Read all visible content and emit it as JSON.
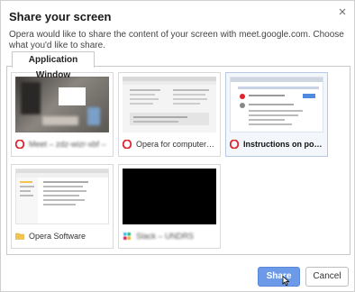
{
  "dialog": {
    "title": "Share your screen",
    "description": "Opera would like to share the content of your screen with meet.google.com. Choose what you'd like to share.",
    "close_icon": "close-icon"
  },
  "tabs": [
    {
      "label": "Application Window",
      "active": true
    }
  ],
  "windows": [
    {
      "label": "Meet – zdz-wizr-xbf –",
      "icon": "opera-icon",
      "blurred": true,
      "bold": false
    },
    {
      "label": "Opera for computers | O...",
      "icon": "opera-icon",
      "blurred": false,
      "bold": false
    },
    {
      "label": "Instructions on postin...",
      "icon": "opera-icon",
      "blurred": false,
      "bold": true,
      "selected": true
    },
    {
      "label": "Opera Software",
      "icon": "folder-icon",
      "blurred": false,
      "bold": false
    },
    {
      "label": "Slack – UNDRS",
      "icon": "slack-icon",
      "blurred": true,
      "bold": false
    }
  ],
  "buttons": {
    "share_label": "Share",
    "cancel_label": "Cancel"
  },
  "colors": {
    "accent": "#6c9ae8",
    "opera_red": "#e0242e",
    "folder_yellow": "#f1c550"
  }
}
